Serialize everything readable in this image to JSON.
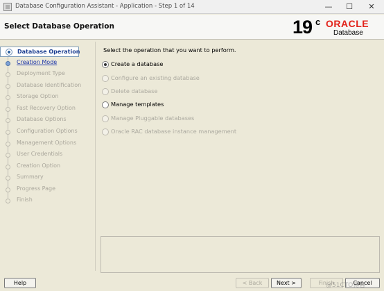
{
  "window": {
    "title": "Database Configuration Assistant - Application - Step 1 of 14",
    "controls": {
      "minimize": "—",
      "maximize": "☐",
      "close": "✕"
    }
  },
  "header": {
    "page_title": "Select Database Operation",
    "logo": {
      "version": "19",
      "version_sup": "c",
      "brand": "ORACLE",
      "product": "Database"
    }
  },
  "sidebar": {
    "steps": [
      {
        "label": "Database Operation",
        "state": "current"
      },
      {
        "label": "Creation Mode",
        "state": "link"
      },
      {
        "label": "Deployment Type",
        "state": "disabled"
      },
      {
        "label": "Database Identification",
        "state": "disabled"
      },
      {
        "label": "Storage Option",
        "state": "disabled"
      },
      {
        "label": "Fast Recovery Option",
        "state": "disabled"
      },
      {
        "label": "Database Options",
        "state": "disabled"
      },
      {
        "label": "Configuration Options",
        "state": "disabled"
      },
      {
        "label": "Management Options",
        "state": "disabled"
      },
      {
        "label": "User Credentials",
        "state": "disabled"
      },
      {
        "label": "Creation Option",
        "state": "disabled"
      },
      {
        "label": "Summary",
        "state": "disabled"
      },
      {
        "label": "Progress Page",
        "state": "disabled"
      },
      {
        "label": "Finish",
        "state": "disabled"
      }
    ]
  },
  "main": {
    "prompt": "Select the operation that you want to perform.",
    "options": [
      {
        "label": "Create a database",
        "selected": true,
        "enabled": true
      },
      {
        "label": "Configure an existing database",
        "selected": false,
        "enabled": false
      },
      {
        "label": "Delete database",
        "selected": false,
        "enabled": false
      },
      {
        "label": "Manage templates",
        "selected": false,
        "enabled": true
      },
      {
        "label": "Manage Pluggable databases",
        "selected": false,
        "enabled": false
      },
      {
        "label": "Oracle RAC database instance management",
        "selected": false,
        "enabled": false
      }
    ]
  },
  "buttons": {
    "help": "Help",
    "back": "< Back",
    "next": "Next >",
    "finish": "Finish",
    "cancel": "Cancel"
  },
  "watermark": "@51CTO博客",
  "colors": {
    "oracle_red": "#e2231a",
    "link_blue": "#1a33a8",
    "current_step": "#1d3f91"
  }
}
